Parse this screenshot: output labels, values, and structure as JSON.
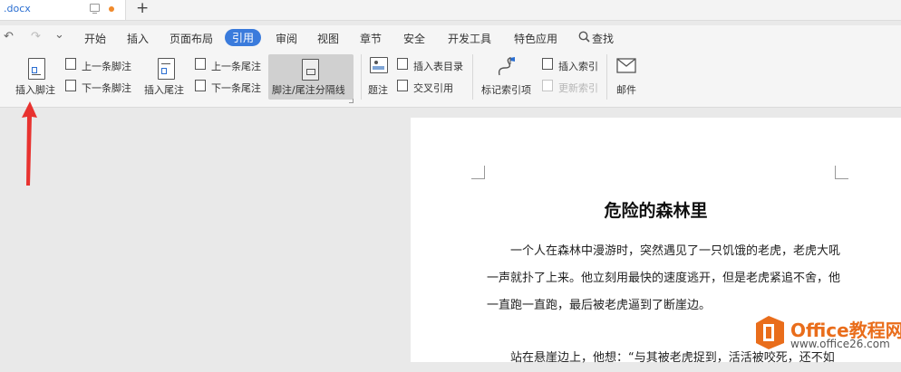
{
  "tab": {
    "doc_name": ".docx",
    "new_tab": "+"
  },
  "quick_access": {
    "undo": "↶",
    "redo": "↷",
    "more": "⌄"
  },
  "menu": {
    "items": [
      "开始",
      "插入",
      "页面布局",
      "引用",
      "审阅",
      "视图",
      "章节",
      "安全",
      "开发工具",
      "特色应用"
    ],
    "active": "引用",
    "search": "查找"
  },
  "ribbon": {
    "insert_footnote": "插入脚注",
    "prev_footnote": "上一条脚注",
    "next_footnote": "下一条脚注",
    "insert_endnote": "插入尾注",
    "prev_endnote": "上一条尾注",
    "next_endnote": "下一条尾注",
    "separator_line": "脚注/尾注分隔线",
    "caption": "题注",
    "insert_toc_figures": "插入表目录",
    "cross_reference": "交叉引用",
    "mark_index_entry": "标记索引项",
    "insert_index": "插入索引",
    "update_index": "更新索引",
    "mail": "邮件"
  },
  "document": {
    "title": "危险的森林里",
    "paragraphs": [
      "一个人在森林中漫游时，突然遇见了一只饥饿的老虎，老虎大吼一声就扑了上来。他立刻用最快的速度逃开，但是老虎紧追不舍，他一直跑一直跑，最后被老虎逼到了断崖边。",
      "站在悬崖边上，他想：“与其被老虎捉到，活活被咬死，还不如"
    ]
  },
  "watermark": {
    "brand": "Office教程网",
    "url": "www.office26.com"
  },
  "colors": {
    "accent": "#3a7bdc",
    "arrow": "#e8322f",
    "watermark": "#e96d1b"
  }
}
